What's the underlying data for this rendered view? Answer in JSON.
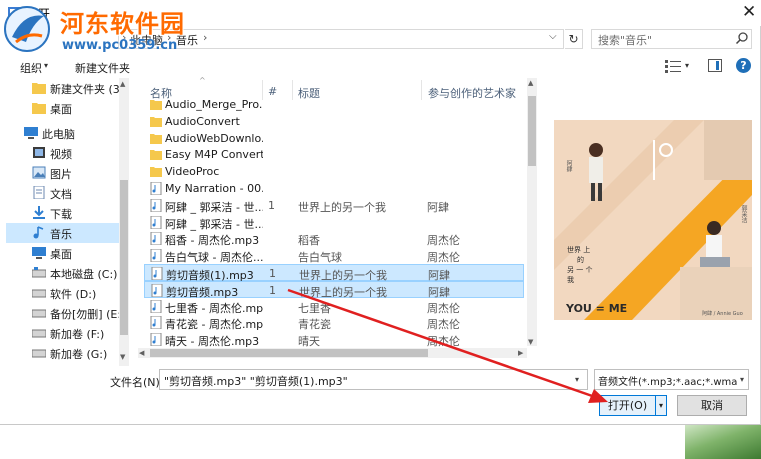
{
  "window": {
    "title": "打开",
    "close_glyph": "✕"
  },
  "watermark": {
    "title": "河东软件园",
    "url": "www.pc0359.cn"
  },
  "address": {
    "crumbs": [
      "此电脑",
      "音乐"
    ],
    "sep": "›",
    "dropdown_glyph": "⌵",
    "refresh_glyph": "↻"
  },
  "search": {
    "placeholder": "搜索\"音乐\""
  },
  "toolbar": {
    "organize": "组织",
    "organize_dd": "▾",
    "new_folder": "新建文件夹",
    "help": "?",
    "view_dd": "▾"
  },
  "nav": {
    "items": [
      {
        "label": "新建文件夹 (3)",
        "icon": "folder-icon"
      },
      {
        "label": "桌面",
        "icon": "folder-icon"
      },
      {
        "label": "此电脑",
        "icon": "computer-icon"
      },
      {
        "label": "视频",
        "icon": "video-icon"
      },
      {
        "label": "图片",
        "icon": "pictures-icon"
      },
      {
        "label": "文档",
        "icon": "documents-icon"
      },
      {
        "label": "下载",
        "icon": "download-icon"
      },
      {
        "label": "音乐",
        "icon": "music-icon",
        "selected": true
      },
      {
        "label": "桌面",
        "icon": "desktop-icon"
      },
      {
        "label": "本地磁盘 (C:)",
        "icon": "drive-icon"
      },
      {
        "label": "软件 (D:)",
        "icon": "drive-icon"
      },
      {
        "label": "备份[勿删] (E:)",
        "icon": "drive-icon"
      },
      {
        "label": "新加卷 (F:)",
        "icon": "drive-icon"
      },
      {
        "label": "新加卷 (G:)",
        "icon": "drive-icon"
      }
    ]
  },
  "columns": {
    "name": "名称",
    "num": "#",
    "title": "标题",
    "artist": "参与创作的艺术家",
    "sort": "^"
  },
  "files": [
    {
      "name": "Audio_Merge_Pro...",
      "num": "",
      "title": "",
      "artist": "",
      "type": "folder"
    },
    {
      "name": "AudioConvert",
      "num": "",
      "title": "",
      "artist": "",
      "type": "folder"
    },
    {
      "name": "AudioWebDownlo...",
      "num": "",
      "title": "",
      "artist": "",
      "type": "folder"
    },
    {
      "name": "Easy M4P Convert...",
      "num": "",
      "title": "",
      "artist": "",
      "type": "folder"
    },
    {
      "name": "VideoProc",
      "num": "",
      "title": "",
      "artist": "",
      "type": "folder"
    },
    {
      "name": "My Narration - 00...",
      "num": "",
      "title": "",
      "artist": "",
      "type": "audio"
    },
    {
      "name": "阿肆 _ 郭采洁 - 世...",
      "num": "1",
      "title": "世界上的另一个我",
      "artist": "阿肆",
      "type": "audio"
    },
    {
      "name": "阿肆 _ 郭采洁 - 世...",
      "num": "",
      "title": "",
      "artist": "",
      "type": "audio"
    },
    {
      "name": "稻香 - 周杰伦.mp3",
      "num": "",
      "title": "稻香",
      "artist": "周杰伦",
      "type": "audio"
    },
    {
      "name": "告白气球 - 周杰伦....",
      "num": "",
      "title": "告白气球",
      "artist": "周杰伦",
      "type": "audio"
    },
    {
      "name": "剪切音频(1).mp3",
      "num": "1",
      "title": "世界上的另一个我",
      "artist": "阿肆",
      "type": "audio",
      "selected": true
    },
    {
      "name": "剪切音频.mp3",
      "num": "1",
      "title": "世界上的另一个我",
      "artist": "阿肆",
      "type": "audio",
      "selected": true
    },
    {
      "name": "七里香 - 周杰伦.mp3",
      "num": "",
      "title": "七里香",
      "artist": "周杰伦",
      "type": "audio"
    },
    {
      "name": "青花瓷 - 周杰伦.mp3",
      "num": "",
      "title": "青花瓷",
      "artist": "周杰伦",
      "type": "audio"
    },
    {
      "name": "晴天 - 周杰伦.mp3",
      "num": "",
      "title": "晴天",
      "artist": "周杰伦",
      "type": "audio"
    }
  ],
  "preview": {
    "album_title": "YOU = ME",
    "lyrics_lines": [
      "世界 上",
      "的",
      "另 一 个",
      "我"
    ],
    "artists": "阿肆 / Annie Guo",
    "names": [
      "阿肆",
      "郭采洁"
    ]
  },
  "bottom": {
    "filename_label": "文件名(N):",
    "filename_value": "\"剪切音频.mp3\" \"剪切音频(1).mp3\"",
    "filetype_value": "音频文件(*.mp3;*.aac;*.wma;*",
    "open_label": "打开(O)",
    "cancel_label": "取消",
    "dd": "▾"
  },
  "colors": {
    "accent": "#0078d7",
    "selection": "#cce8ff",
    "watermark": "#ff6a00",
    "arrow": "#e02020"
  }
}
